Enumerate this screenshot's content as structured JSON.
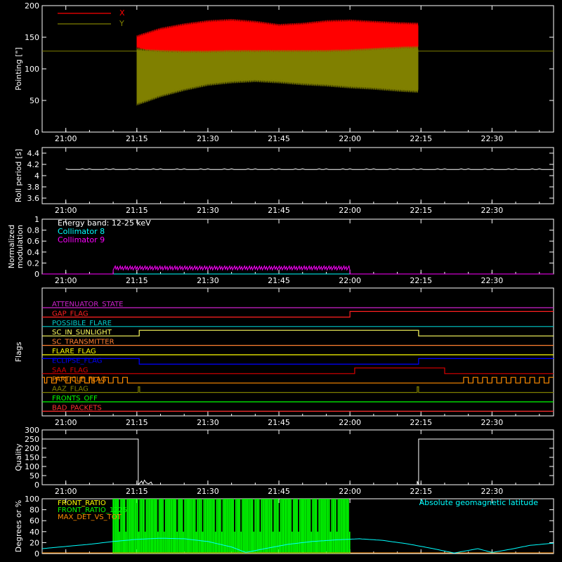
{
  "colors": {
    "background": "#000000",
    "axis": "#ffffff",
    "x_series": "#ff0000",
    "y_series": "#808000",
    "cyan": "#00ffff",
    "magenta": "#ff00ff",
    "flag_attenuator": "#cc22cc",
    "flag_gap": "#ff2020",
    "flag_possible_flare": "#00cccc",
    "flag_sunlight": "#ffff60",
    "flag_transmitter": "#ff7f30",
    "flag_flare": "#ffff00",
    "flag_eclipse": "#0000ff",
    "flag_saa": "#dd0000",
    "flag_particle": "#ff8c00",
    "flag_aaz": "#808000",
    "flag_fronts_off": "#00ff00",
    "flag_bad_packets": "#ff3030",
    "green": "#00ff00",
    "orange": "#ff8c00",
    "white": "#ffffff"
  },
  "time_axis": {
    "min_minutes_after_2100": -5,
    "max_minutes_after_2100": 103,
    "ticks": [
      {
        "label": "21:00",
        "t": 0
      },
      {
        "label": "21:15",
        "t": 15
      },
      {
        "label": "21:30",
        "t": 30
      },
      {
        "label": "21:45",
        "t": 45
      },
      {
        "label": "22:00",
        "t": 60
      },
      {
        "label": "22:15",
        "t": 75
      },
      {
        "label": "22:30",
        "t": 90
      }
    ]
  },
  "chart_data": [
    {
      "id": "pointing",
      "type": "area",
      "ylabel": "Pointing [\"]",
      "ylim": [
        0,
        200
      ],
      "yticks": [
        0,
        50,
        100,
        150,
        200
      ],
      "legend": {
        "placement": "top-left",
        "entries": [
          "X",
          "Y"
        ]
      },
      "constant_line": 128,
      "x_series": {
        "name": "X",
        "t": [
          15,
          17,
          20,
          25,
          30,
          35,
          40,
          45,
          50,
          55,
          60,
          65,
          70,
          74.5
        ],
        "upper": [
          150,
          155,
          162,
          169,
          174,
          176,
          173,
          168,
          170,
          174,
          175,
          173,
          171,
          170
        ],
        "lower": [
          135,
          130,
          128,
          126,
          126,
          127,
          127,
          127,
          127,
          127,
          128,
          130,
          132,
          133
        ]
      },
      "y_series": {
        "name": "Y",
        "t": [
          15,
          17,
          20,
          25,
          30,
          35,
          40,
          45,
          50,
          55,
          60,
          65,
          70,
          74.5
        ],
        "upper": [
          130,
          128,
          127,
          126,
          126,
          127,
          127,
          127,
          127,
          127,
          128,
          130,
          132,
          133
        ],
        "lower": [
          45,
          50,
          58,
          68,
          76,
          80,
          82,
          80,
          77,
          75,
          72,
          70,
          67,
          65
        ]
      }
    },
    {
      "id": "roll_period",
      "type": "line",
      "ylabel": "Roll period [s]",
      "ylim": [
        3.5,
        4.5
      ],
      "yticks": [
        3.6,
        3.8,
        4.0,
        4.2,
        4.4
      ],
      "t_range": [
        0,
        103
      ],
      "value": 4.11
    },
    {
      "id": "modulation",
      "type": "line",
      "ylabel": "Normalized modulation",
      "ylim": [
        0,
        1.0
      ],
      "yticks": [
        0.0,
        0.2,
        0.4,
        0.6,
        0.8,
        1.0
      ],
      "legend": {
        "placement": "top-left",
        "entries": [
          "Energy band: 12-25 keV",
          "Collimator 8",
          "Collimator 9"
        ]
      },
      "series": [
        {
          "name": "Collimator 8",
          "t": [
            -5,
            103
          ],
          "values": [
            0.0,
            0.0
          ]
        },
        {
          "name": "Collimator 9",
          "t": [
            -5,
            10,
            10,
            60,
            60,
            103
          ],
          "values": [
            0.0,
            0.0,
            0.11,
            0.11,
            0.0,
            0.0
          ]
        }
      ]
    },
    {
      "id": "flags",
      "type": "line",
      "ylabel": "Flags",
      "flags": [
        {
          "label": "ATTENUATOR_STATE",
          "color": "flag_attenuator",
          "steps": [
            [
              -5,
              0
            ]
          ]
        },
        {
          "label": "GAP_FLAG",
          "color": "flag_gap",
          "steps": [
            [
              -5,
              0
            ],
            [
              60,
              1
            ]
          ]
        },
        {
          "label": "POSSIBLE_FLARE",
          "color": "flag_possible_flare",
          "steps": [
            [
              -5,
              0
            ]
          ]
        },
        {
          "label": "SC_IN_SUNLIGHT",
          "color": "flag_sunlight",
          "steps": [
            [
              -5,
              0
            ],
            [
              15.5,
              1
            ],
            [
              74.5,
              0
            ]
          ]
        },
        {
          "label": "SC_TRANSMITTER",
          "color": "flag_transmitter",
          "steps": [
            [
              -5,
              0
            ]
          ]
        },
        {
          "label": "FLARE_FLAG",
          "color": "flag_flare",
          "steps": [
            [
              -5,
              0
            ]
          ]
        },
        {
          "label": "ECLIPSE_FLAG",
          "color": "flag_eclipse",
          "steps": [
            [
              -5,
              1
            ],
            [
              15.5,
              0
            ],
            [
              74.5,
              1
            ]
          ]
        },
        {
          "label": "SAA_FLAG",
          "color": "flag_saa",
          "steps": [
            [
              -5,
              0
            ],
            [
              61,
              1
            ],
            [
              80,
              0
            ]
          ]
        },
        {
          "label": "PARTICLE_FLAG",
          "color": "flag_particle",
          "steps": [
            [
              -5,
              1
            ],
            [
              -4.5,
              0
            ],
            [
              -4,
              1
            ],
            [
              -3,
              0
            ],
            [
              -2,
              1
            ],
            [
              0,
              0
            ],
            [
              1,
              1
            ],
            [
              2,
              0
            ],
            [
              3,
              1
            ],
            [
              4,
              0
            ],
            [
              5,
              1
            ],
            [
              5.5,
              0
            ],
            [
              6,
              1
            ],
            [
              7,
              0
            ],
            [
              8,
              1
            ],
            [
              9,
              0
            ],
            [
              10,
              1
            ],
            [
              11,
              0
            ],
            [
              12,
              1
            ],
            [
              13,
              0
            ],
            [
              84,
              1
            ],
            [
              85,
              0
            ],
            [
              86,
              1
            ],
            [
              87,
              0
            ],
            [
              88,
              1
            ],
            [
              89,
              0
            ],
            [
              90,
              1
            ],
            [
              91,
              0
            ],
            [
              92,
              1
            ],
            [
              93,
              0
            ],
            [
              94,
              1
            ],
            [
              95,
              0
            ],
            [
              96,
              1
            ],
            [
              97,
              0
            ],
            [
              98,
              1
            ],
            [
              99,
              0
            ],
            [
              100,
              1
            ],
            [
              101,
              0
            ],
            [
              102,
              1
            ]
          ]
        },
        {
          "label": "AAZ_FLAG",
          "color": "flag_aaz",
          "steps": [
            [
              -5,
              0
            ],
            [
              15.3,
              1
            ],
            [
              15.6,
              0
            ],
            [
              74.2,
              1
            ],
            [
              74.5,
              0
            ]
          ]
        },
        {
          "label": "FRONTS_OFF",
          "color": "flag_fronts_off",
          "steps": [
            [
              -5,
              0
            ]
          ]
        },
        {
          "label": "BAD_PACKETS",
          "color": "flag_bad_packets",
          "steps": [
            [
              -5,
              0
            ]
          ]
        }
      ]
    },
    {
      "id": "quality",
      "type": "line",
      "ylabel": "Quality",
      "ylim": [
        0,
        300
      ],
      "yticks": [
        0,
        50,
        100,
        150,
        200,
        250,
        300
      ],
      "t": [
        -5,
        15.3,
        15.3,
        16,
        16.3,
        16.6,
        17,
        17.5,
        18,
        18.3,
        74.2,
        74.2,
        74.5,
        74.5,
        103
      ],
      "values": [
        250,
        250,
        0,
        20,
        5,
        25,
        10,
        5,
        15,
        0,
        0,
        20,
        0,
        250,
        250
      ]
    },
    {
      "id": "front_ratio",
      "type": "line",
      "ylabel": "Degrees or %",
      "ylim": [
        0,
        100
      ],
      "yticks": [
        0,
        20,
        40,
        60,
        80,
        100
      ],
      "legend": {
        "placement": "top-left",
        "entries": [
          "FRONT_RATIO",
          "FRONT_RATIO_1225",
          "MAX_DET_VS_TOT"
        ]
      },
      "annotation": "Absolute geomagnetic latitude",
      "front_ratio_1225_t_range": [
        10,
        60
      ],
      "latitude": {
        "t": [
          -5,
          5,
          10,
          15,
          20,
          25,
          30,
          35,
          38,
          42,
          47,
          52,
          57,
          62,
          67,
          72,
          77,
          82,
          87,
          90,
          94,
          98,
          103
        ],
        "values": [
          9,
          17,
          22,
          26,
          28,
          27,
          22,
          12,
          2,
          9,
          17,
          22,
          25,
          27,
          24,
          18,
          10,
          1,
          9,
          2,
          8,
          15,
          19
        ]
      }
    }
  ],
  "x_series_label": "X",
  "y_series_label": "Y",
  "mod_legend_title": "Energy band: 12-25 keV",
  "mod_legend_c8": "Collimator 8",
  "mod_legend_c9": "Collimator 9",
  "fr_legend_1": "FRONT_RATIO",
  "fr_legend_2": "FRONT_RATIO_1225",
  "fr_legend_3": "MAX_DET_VS_TOT",
  "fr_annotation": "Absolute geomagnetic latitude"
}
